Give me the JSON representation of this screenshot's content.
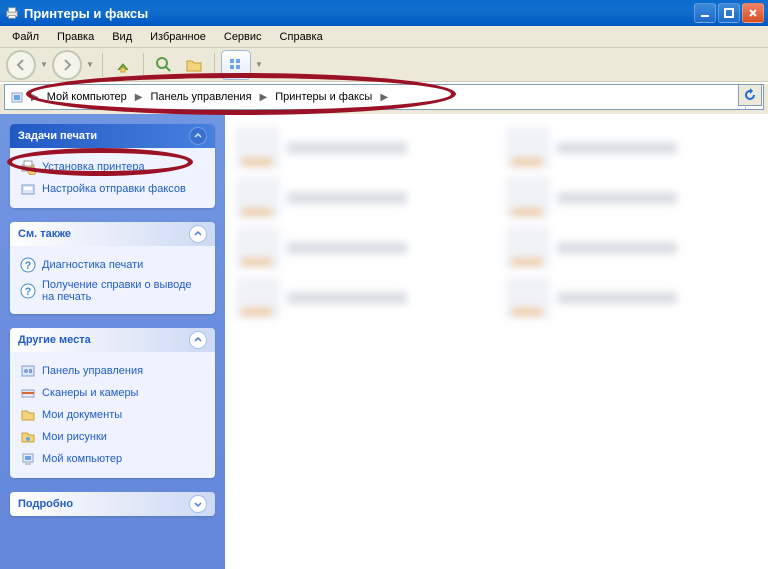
{
  "window": {
    "title": "Принтеры и факсы"
  },
  "menu": {
    "file": "Файл",
    "edit": "Правка",
    "view": "Вид",
    "favorites": "Избранное",
    "tools": "Сервис",
    "help": "Справка"
  },
  "breadcrumb": {
    "items": [
      {
        "label": "Мой компьютер"
      },
      {
        "label": "Панель управления"
      },
      {
        "label": "Принтеры и факсы"
      }
    ]
  },
  "sidebar": {
    "tasks": {
      "title": "Задачи печати",
      "add_printer": "Установка принтера",
      "fax_setup": "Настройка отправки факсов"
    },
    "see_also": {
      "title": "См. также",
      "troubleshoot": "Диагностика печати",
      "help": "Получение справки о выводе на печать"
    },
    "other_places": {
      "title": "Другие места",
      "control_panel": "Панель управления",
      "scanners": "Сканеры и камеры",
      "documents": "Мои документы",
      "pictures": "Мои рисунки",
      "computer": "Мой компьютер"
    },
    "details": {
      "title": "Подробно"
    }
  }
}
